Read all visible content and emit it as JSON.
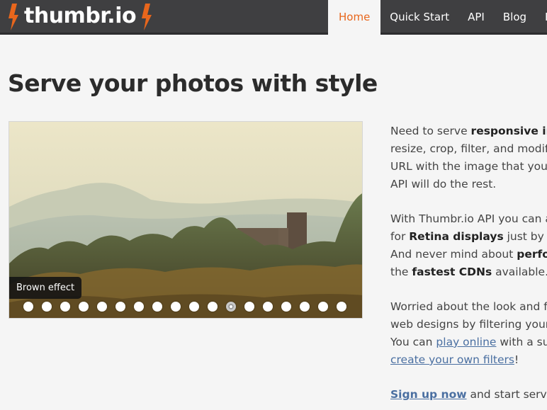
{
  "brand": {
    "name": "thumbr.io",
    "accent": "#e8661c"
  },
  "nav": {
    "items": [
      {
        "label": "Home",
        "active": true
      },
      {
        "label": "Quick Start"
      },
      {
        "label": "API"
      },
      {
        "label": "Blog"
      },
      {
        "label": "Pla"
      }
    ]
  },
  "main": {
    "title": "Serve your photos with style",
    "slider": {
      "caption": "Brown effect",
      "dot_count": 18,
      "active_dot": 12
    },
    "paragraphs": [
      {
        "lines": [
          {
            "t1": "Need to serve ",
            "b1": "responsive ima"
          },
          {
            "t1": "resize, crop, filter, and modify"
          },
          {
            "t1": "URL with the image that you"
          },
          {
            "t1": "API will do the rest."
          }
        ]
      },
      {
        "lines": [
          {
            "t1": "With Thumbr.io API you can a"
          },
          {
            "t1": "for ",
            "b1": "Retina displays",
            "t2": " just by ad"
          },
          {
            "t1": "And never mind about ",
            "b1": "perfor"
          },
          {
            "t1": "the ",
            "b1": "fastest CDNs",
            "t2": " available."
          }
        ]
      },
      {
        "lines": [
          {
            "t1": "Worried about the look and f"
          },
          {
            "t1": "web designs by filtering your"
          },
          {
            "t1": "You can ",
            "a1": "play online",
            "t2": " with a su"
          },
          {
            "a1": "create your own filters",
            "t2": "!"
          }
        ]
      }
    ],
    "signup": {
      "link": "Sign up now",
      "rest": " and start servin"
    }
  }
}
